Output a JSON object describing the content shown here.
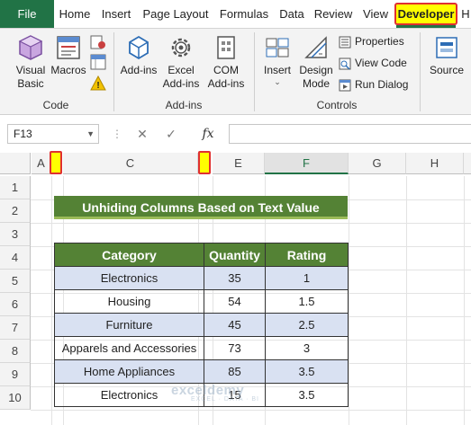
{
  "tabs": [
    "File",
    "Home",
    "Insert",
    "Page Layout",
    "Formulas",
    "Data",
    "Review",
    "View",
    "Developer",
    "H"
  ],
  "ribbon": {
    "code": {
      "visual_basic": "Visual Basic",
      "macros": "Macros",
      "label": "Code"
    },
    "addins": {
      "addins": "Add-ins",
      "excel_addins": "Excel Add-ins",
      "com_addins": "COM Add-ins",
      "label": "Add-ins"
    },
    "controls": {
      "insert": "Insert",
      "design_mode": "Design Mode",
      "properties": "Properties",
      "view_code": "View Code",
      "run_dialog": "Run Dialog",
      "label": "Controls"
    },
    "source": "Source"
  },
  "formula_bar": {
    "name_box": "F13",
    "fx": "fx",
    "value": ""
  },
  "columns": [
    "A",
    "C",
    "E",
    "F",
    "G",
    "H"
  ],
  "rows": [
    "1",
    "2",
    "3",
    "4",
    "5",
    "6",
    "7",
    "8",
    "9",
    "10"
  ],
  "title": "Unhiding Columns Based on Text Value",
  "table": {
    "headers": [
      "Category",
      "Quantity",
      "Rating"
    ],
    "rows": [
      [
        "Electronics",
        "35",
        "1"
      ],
      [
        "Housing",
        "54",
        "1.5"
      ],
      [
        "Furniture",
        "45",
        "2.5"
      ],
      [
        "Apparels and Accessories",
        "73",
        "3"
      ],
      [
        "Home Appliances",
        "85",
        "3.5"
      ],
      [
        "Electronics",
        "15",
        "3.5"
      ]
    ]
  },
  "watermark": {
    "name": "exceldemy",
    "tagline": "EXCEL · DATA · BI"
  },
  "colors": {
    "excel_green": "#217346",
    "header_green": "#548235",
    "band_blue": "#d9e1f2",
    "highlight_yellow": "#ffff00",
    "highlight_red": "#e03030"
  }
}
